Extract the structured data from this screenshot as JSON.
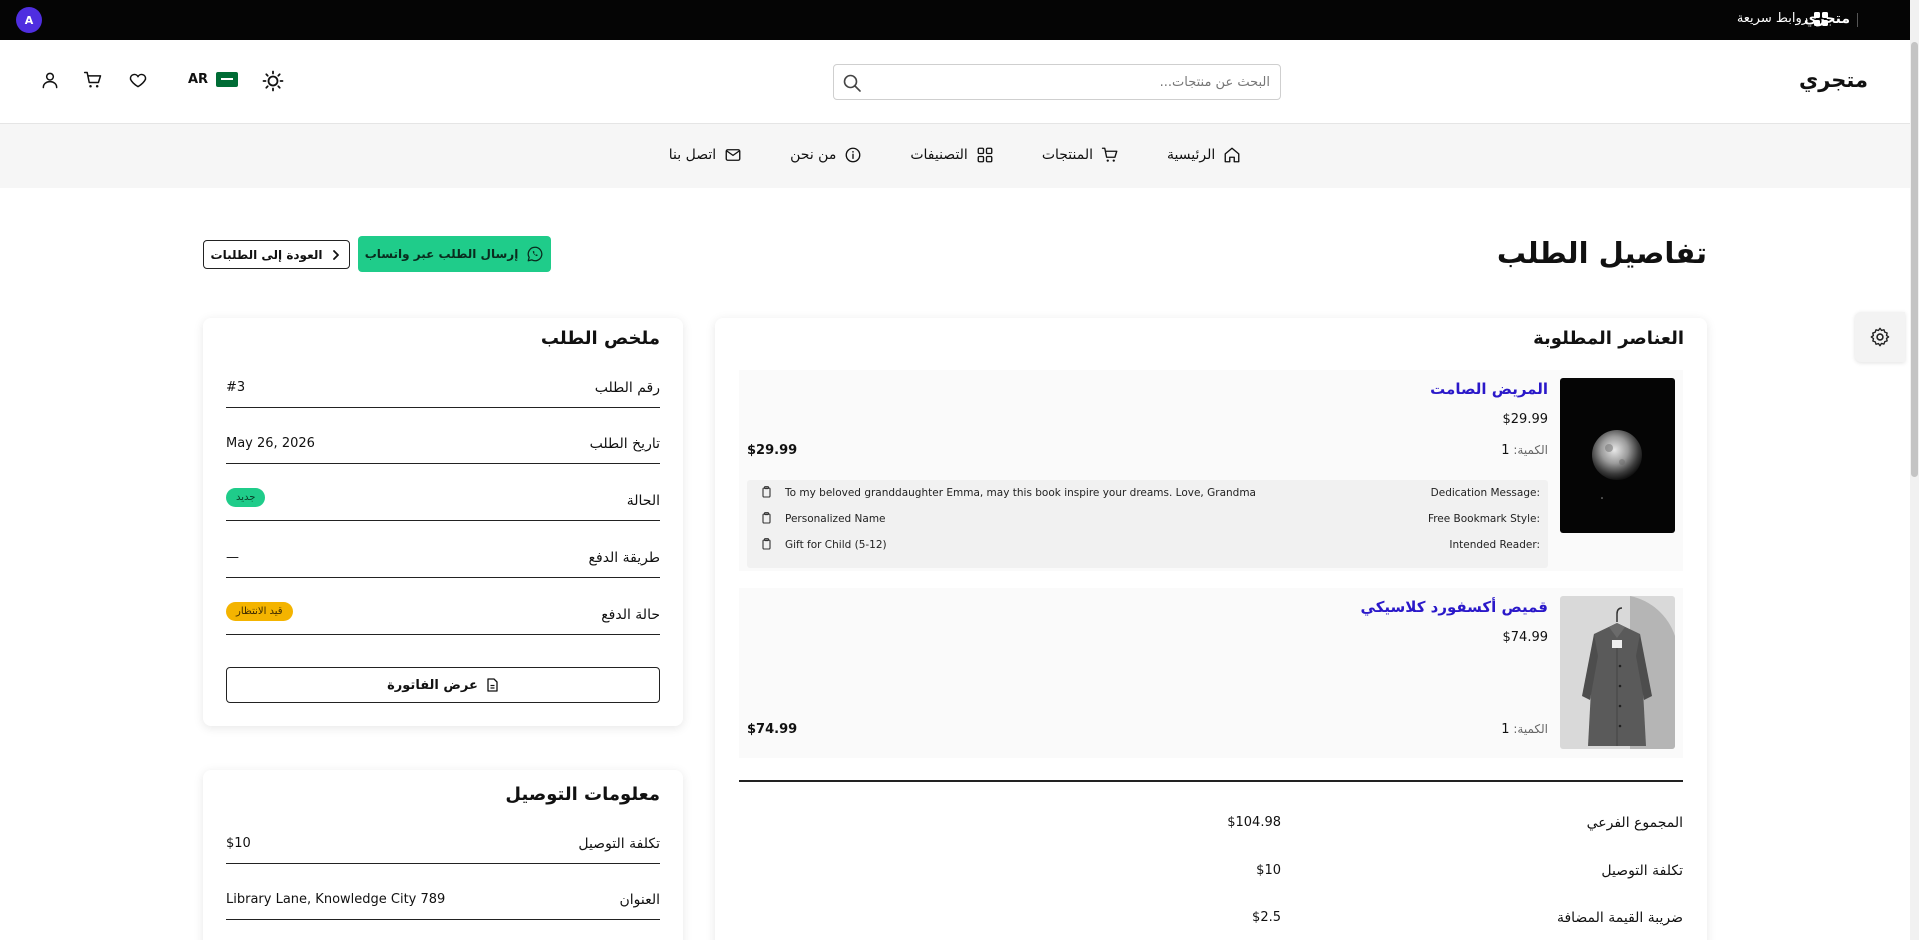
{
  "topbar": {
    "brand": "متجري",
    "quick_links": "روابط سريعة",
    "avatar_initial": "A",
    "avatar_color": "#4f2ee0"
  },
  "header": {
    "logo": "متجري",
    "search_placeholder": "البحث عن منتجات...",
    "lang_code": "AR"
  },
  "nav": [
    {
      "label": "الرئيسية",
      "icon": "home-icon"
    },
    {
      "label": "المنتجات",
      "icon": "cart-icon"
    },
    {
      "label": "التصنيفات",
      "icon": "grid-icon"
    },
    {
      "label": "من نحن",
      "icon": "info-icon"
    },
    {
      "label": "اتصل بنا",
      "icon": "mail-icon"
    }
  ],
  "page": {
    "title": "تفاصيل الطلب",
    "whatsapp_button": "إرسال الطلب عبر واتساب",
    "back_button": "العودة إلى الطلبات"
  },
  "summary": {
    "title": "ملخص الطلب",
    "rows": [
      {
        "label": "رقم الطلب",
        "value": "#3"
      },
      {
        "label": "تاريخ الطلب",
        "value": "May 26, 2026"
      },
      {
        "label": "الحالة",
        "value": "جديد"
      },
      {
        "label": "طريقة الدفع",
        "value": "—"
      },
      {
        "label": "حالة الدفع",
        "value": "قيد الانتظار"
      }
    ],
    "invoice_button": "عرض الفاتورة"
  },
  "delivery": {
    "title": "معلومات التوصيل",
    "rows": [
      {
        "label": "تكلفة التوصيل",
        "value": "$10"
      },
      {
        "label": "العنوان",
        "value": "Library Lane, Knowledge City 789"
      }
    ]
  },
  "items": {
    "title": "العناصر المطلوبة",
    "qty_label": "الكمية:",
    "list": [
      {
        "name": "المريض الصامت",
        "price": "$29.99",
        "qty": "1",
        "line_total": "$29.99",
        "options": [
          {
            "key": "Dedication Message:",
            "value": "To my beloved granddaughter Emma, may this book inspire your dreams. Love, Grandma"
          },
          {
            "key": "Free Bookmark Style:",
            "value": "Personalized Name"
          },
          {
            "key": "Intended Reader:",
            "value": "Gift for Child (5-12)"
          }
        ]
      },
      {
        "name": "قميص أكسفورد كلاسيكي",
        "price": "$74.99",
        "qty": "1",
        "line_total": "$74.99"
      }
    ],
    "totals": [
      {
        "label": "المجموع الفرعي",
        "value": "$104.98"
      },
      {
        "label": "تكلفة التوصيل",
        "value": "$10"
      },
      {
        "label": "ضريبة القيمة المضافة",
        "value": "$2.5"
      }
    ]
  },
  "colors": {
    "accent": "#1fcc8a",
    "link": "#2a18c9",
    "pending": "#f4b400",
    "topbar": "#050505"
  }
}
